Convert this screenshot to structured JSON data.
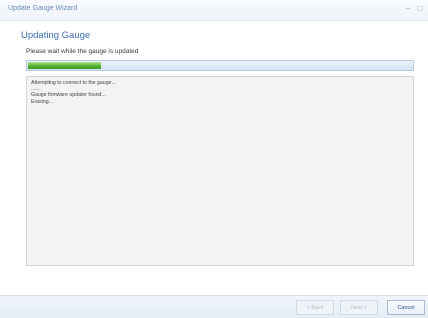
{
  "window": {
    "title": "Update Gauge Wizard",
    "minimize_glyph": "–",
    "maximize_glyph": "□",
    "close_glyph": "×"
  },
  "page": {
    "heading": "Updating Gauge",
    "wait_text": "Please wait while the gauge is updated"
  },
  "progress": {
    "percent": 19,
    "fill_color": "#55b332"
  },
  "log": {
    "lines": [
      "Attempting to connect to the gauge...",
      "......",
      "Gauge firmware updater found...",
      "Erasing..."
    ]
  },
  "footer": {
    "back_label": "< Back",
    "next_label": "Next >",
    "cancel_label": "Cancel"
  }
}
